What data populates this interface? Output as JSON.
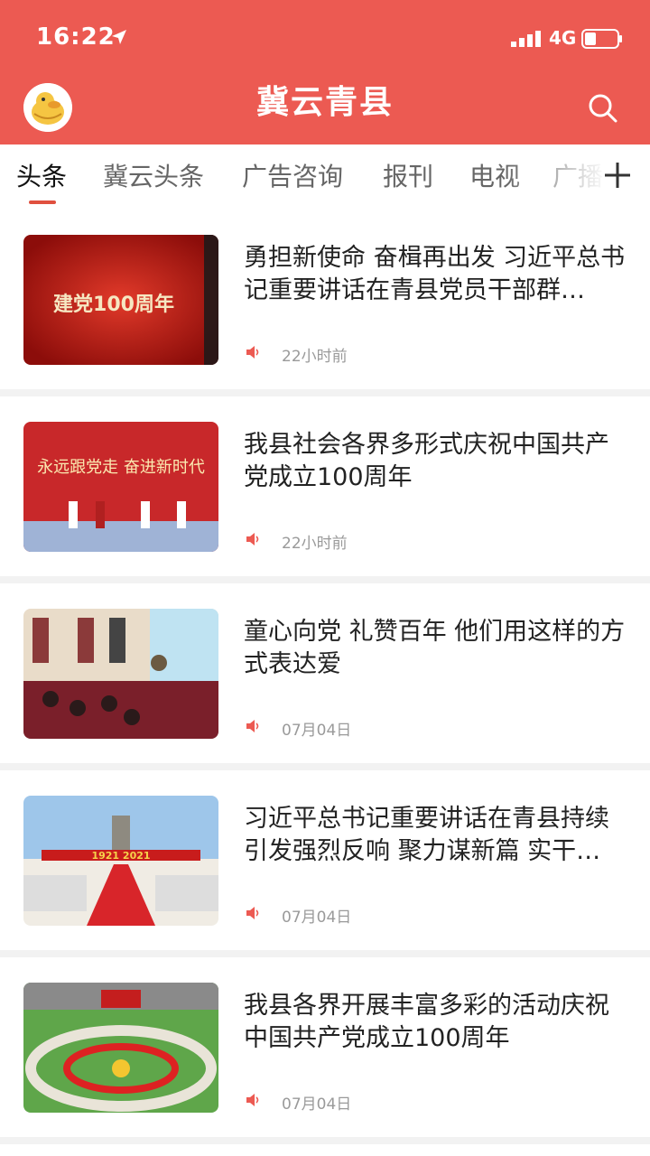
{
  "status_bar": {
    "time": "16:22",
    "network": "4G",
    "icons": [
      "location-arrow-icon",
      "signal-icon",
      "battery-icon"
    ]
  },
  "header": {
    "title": "冀云青县",
    "avatar_icon": "duck-avatar-icon",
    "search_icon": "search-icon",
    "background_color": "#ec5a52"
  },
  "tabs": {
    "items": [
      {
        "label": "头条",
        "active": true
      },
      {
        "label": "冀云头条",
        "active": false
      },
      {
        "label": "广告咨询",
        "active": false
      },
      {
        "label": "报刊",
        "active": false
      },
      {
        "label": "电视",
        "active": false
      },
      {
        "label": "广播",
        "active": false
      }
    ],
    "add_icon": "plus-icon",
    "active_color": "#e0503f"
  },
  "feed": {
    "items": [
      {
        "title": "勇担新使命 奋楫再出发 习近平总书记重要讲话在青县党员干部群…",
        "time": "22小时前",
        "thumb": "建党100周年"
      },
      {
        "title": "我县社会各界多形式庆祝中国共产党成立100周年",
        "time": "22小时前",
        "thumb": "永远跟党走 奋进新时代"
      },
      {
        "title": "童心向党 礼赞百年 他们用这样的方式表达爱",
        "time": "07月04日",
        "thumb": ""
      },
      {
        "title": "习近平总书记重要讲话在青县持续引发强烈反响 聚力谋新篇 实干…",
        "time": "07月04日",
        "thumb": "1921 2021"
      },
      {
        "title": "我县各界开展丰富多彩的活动庆祝中国共产党成立100周年",
        "time": "07月04日",
        "thumb": ""
      }
    ],
    "audio_icon": "speaker-icon"
  }
}
